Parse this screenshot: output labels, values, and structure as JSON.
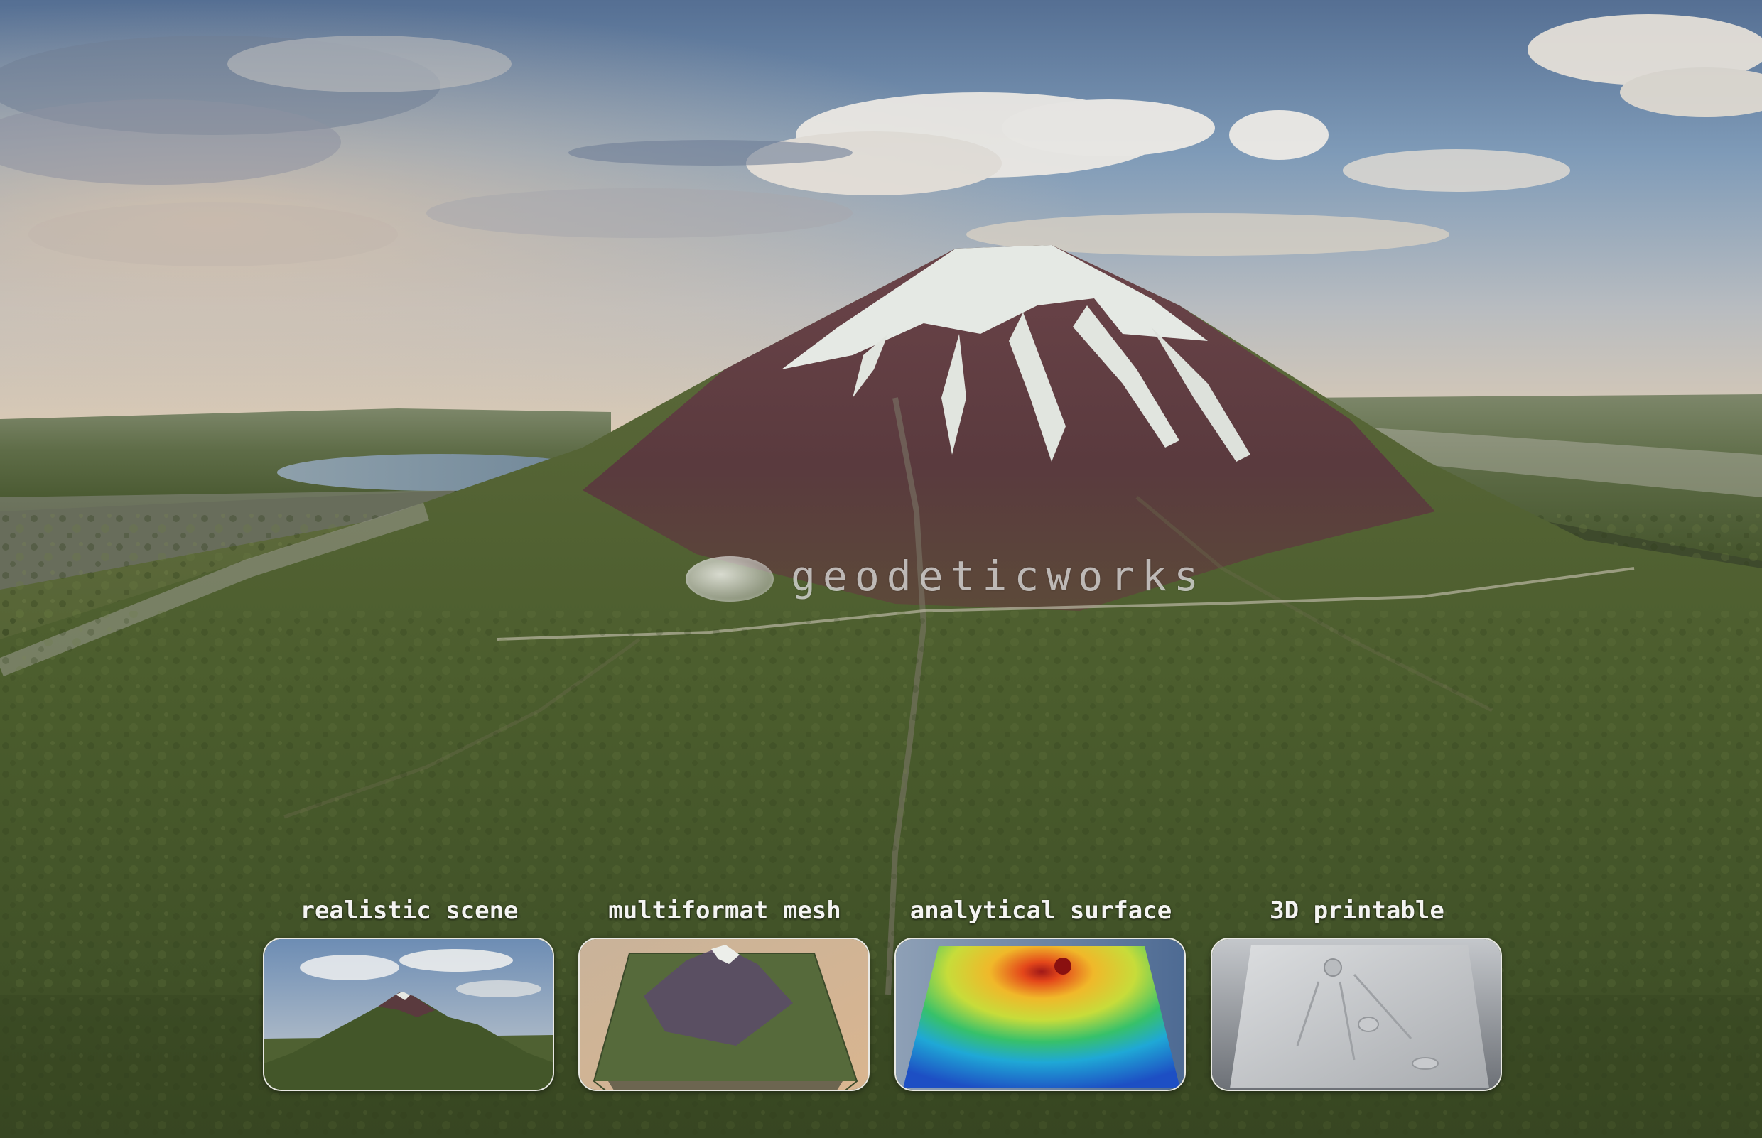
{
  "brand": {
    "logo_text": "geodeticworks",
    "logo_icon": "terrain-disc-icon"
  },
  "cards": [
    {
      "label": "realistic scene",
      "thumb": "realistic-scene-thumbnail"
    },
    {
      "label": "multiformat mesh",
      "thumb": "multiformat-mesh-thumbnail"
    },
    {
      "label": "analytical surface",
      "thumb": "analytical-surface-thumbnail"
    },
    {
      "label": "3D printable",
      "thumb": "3d-printable-thumbnail"
    }
  ],
  "colors": {
    "sky_top": "#5f7fa6",
    "sky_horizon": "#d9cdb8",
    "forest": "#4d5f31",
    "rock": "#5e3a3f",
    "snow": "#e7ebe6",
    "card_border": "#e9e9e4",
    "label_text": "#f4f4f2"
  }
}
